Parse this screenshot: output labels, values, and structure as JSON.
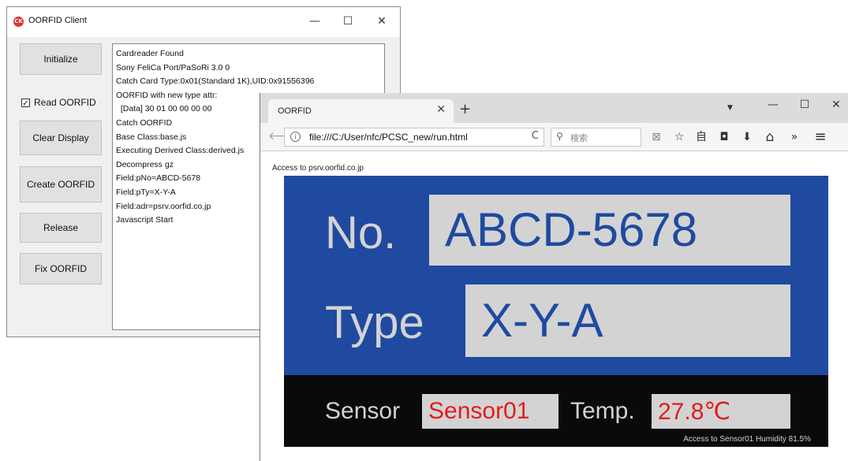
{
  "client": {
    "title": "OORFID Client",
    "icon_text": "CK",
    "window_controls": {
      "minimize": "—",
      "maximize": "☐",
      "close": "✕"
    },
    "buttons": {
      "initialize": "Initialize",
      "clear_display": "Clear Display",
      "create_oorfid": "Create OORFID",
      "release": "Release",
      "fix_oorfid": "Fix OORFID"
    },
    "checkbox": {
      "label": "Read OORFID",
      "checked_mark": "✓"
    },
    "log": [
      "Cardreader Found",
      "Sony FeliCa Port/PaSoRi 3.0 0",
      "Catch Card Type:0x01(Standard 1K),UID:0x91556396",
      "OORFID with new type attr:",
      "  [Data] 30 01 00 00 00 00",
      "Catch OORFID",
      "Base Class:base.js",
      "Executing Derived Class:derived.js",
      "Decompress gz",
      "Field:pNo=ABCD-5678",
      "Field:pTy=X-Y-A",
      "Field:adr=psrv.oorfid.co.jp",
      "Javascript Start"
    ]
  },
  "browser": {
    "tab_title": "OORFID",
    "tab_close": "✕",
    "new_tab": "+",
    "tab_dropdown": "▼",
    "window_controls": {
      "minimize": "—",
      "maximize": "☐",
      "close": "✕"
    },
    "back_icon": "🡐",
    "info_icon": "i",
    "url": "file:///C:/User/nfc/PCSC_new/run.html",
    "reload_icon": "C",
    "search_icon": "⚲",
    "search_placeholder": "検索",
    "toolbar_icons": {
      "reader": "⊠",
      "bookmark": "☆",
      "library": "自",
      "pocket": "◘",
      "download": "⬇",
      "home": "⌂",
      "overflow": "»",
      "menu": "≡"
    },
    "page": {
      "access_top": "Access to psrv.oorfid.co.jp",
      "no_label": "No.",
      "no_value": "ABCD-5678",
      "type_label": "Type",
      "type_value": "X-Y-A",
      "sensor_label": "Sensor",
      "sensor_value": "Sensor01",
      "temp_label": "Temp.",
      "temp_value": "27.8℃",
      "status_line": "Access to Sensor01  Humidity 81.5%"
    },
    "colors": {
      "panel_blue": "#1f4aa0",
      "panel_black": "#0a0a0a",
      "value_box": "#d3d3d3",
      "sensor_text_red": "#e21c1c"
    }
  }
}
